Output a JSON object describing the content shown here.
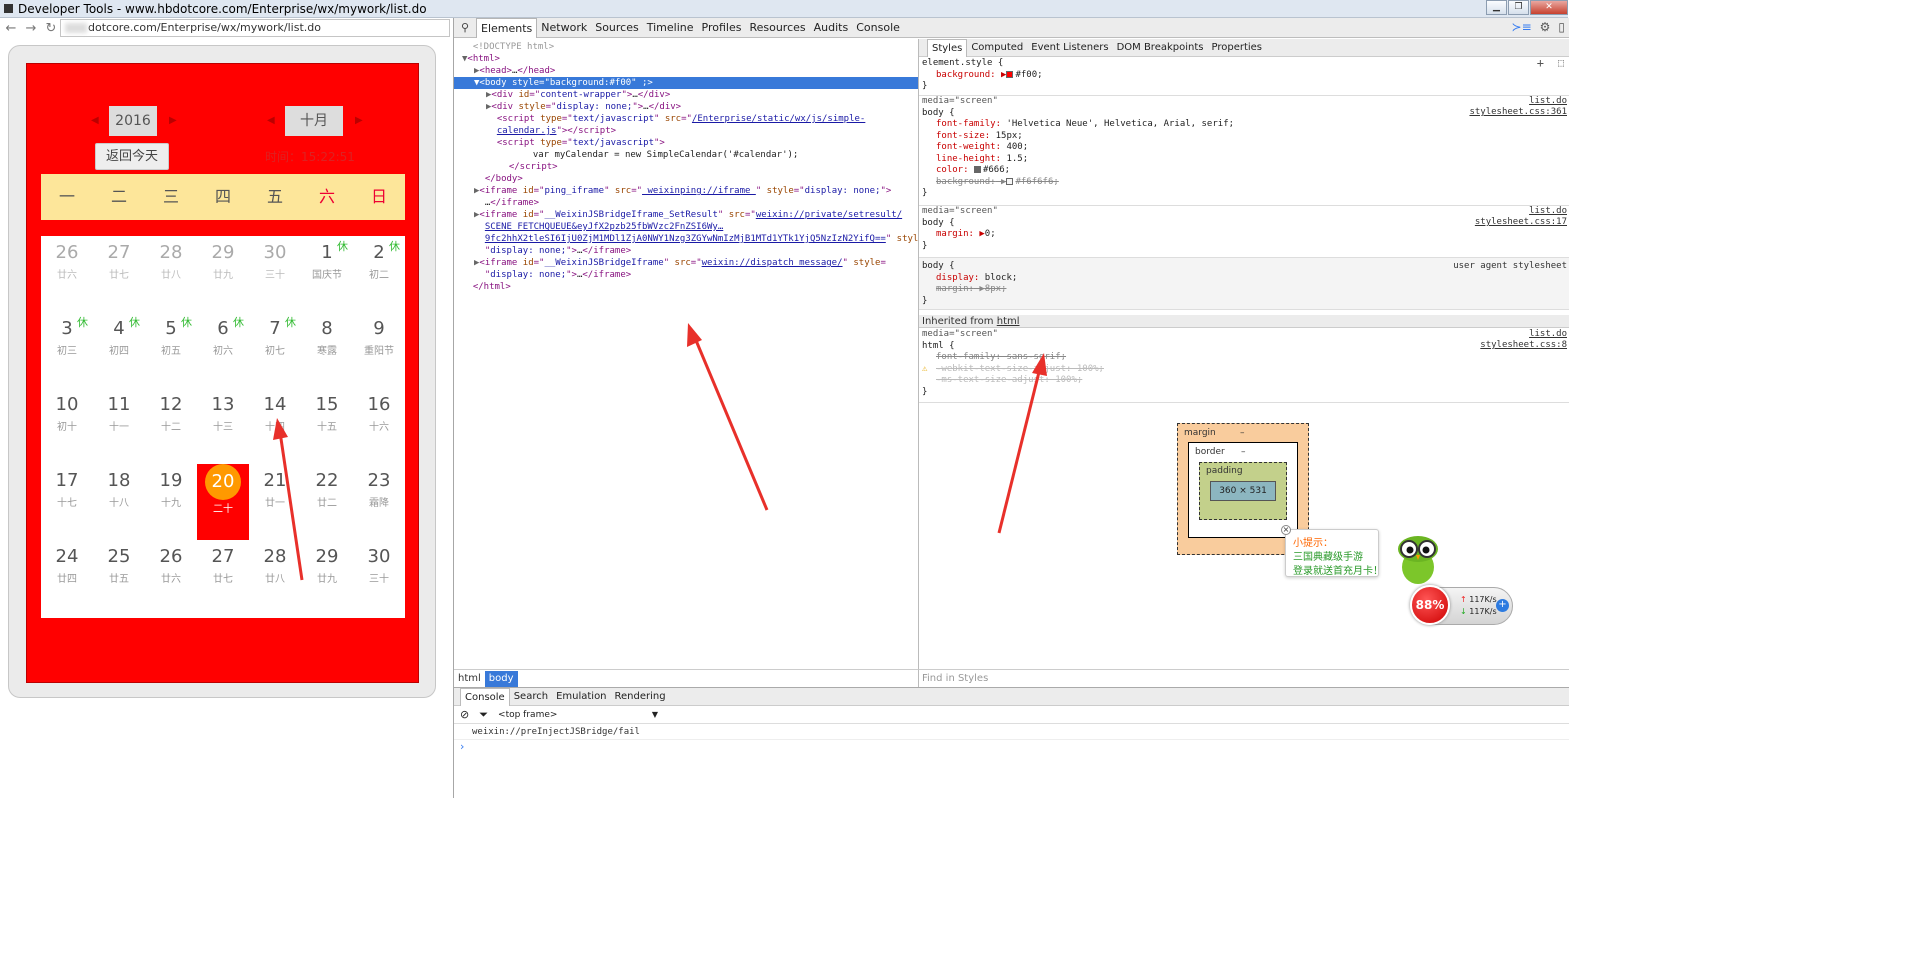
{
  "window": {
    "title": "Developer Tools - www.hbdotcore.com/Enterprise/wx/mywork/list.do"
  },
  "address": {
    "url": "dotcore.com/Enterprise/wx/mywork/list.do"
  },
  "calendar": {
    "year": "2016",
    "month": "十月",
    "today_button": "返回今天",
    "time_text": "时间：15:22:51",
    "weekdays": [
      "一",
      "二",
      "三",
      "四",
      "五",
      "六",
      "日"
    ],
    "days": [
      {
        "n": "26",
        "l": "廿六",
        "dim": true
      },
      {
        "n": "27",
        "l": "廿七",
        "dim": true
      },
      {
        "n": "28",
        "l": "廿八",
        "dim": true
      },
      {
        "n": "29",
        "l": "廿九",
        "dim": true
      },
      {
        "n": "30",
        "l": "三十",
        "dim": true
      },
      {
        "n": "1",
        "l": "国庆节",
        "rest": "休"
      },
      {
        "n": "2",
        "l": "初二",
        "rest": "休"
      },
      {
        "n": "3",
        "l": "初三",
        "rest": "休"
      },
      {
        "n": "4",
        "l": "初四",
        "rest": "休"
      },
      {
        "n": "5",
        "l": "初五",
        "rest": "休"
      },
      {
        "n": "6",
        "l": "初六",
        "rest": "休"
      },
      {
        "n": "7",
        "l": "初七",
        "rest": "休"
      },
      {
        "n": "8",
        "l": "寒露"
      },
      {
        "n": "9",
        "l": "重阳节"
      },
      {
        "n": "10",
        "l": "初十"
      },
      {
        "n": "11",
        "l": "十一"
      },
      {
        "n": "12",
        "l": "十二"
      },
      {
        "n": "13",
        "l": "十三"
      },
      {
        "n": "14",
        "l": "十四"
      },
      {
        "n": "15",
        "l": "十五"
      },
      {
        "n": "16",
        "l": "十六"
      },
      {
        "n": "17",
        "l": "十七"
      },
      {
        "n": "18",
        "l": "十八"
      },
      {
        "n": "19",
        "l": "十九"
      },
      {
        "n": "20",
        "l": "二十",
        "today": true
      },
      {
        "n": "21",
        "l": "廿一"
      },
      {
        "n": "22",
        "l": "廿二"
      },
      {
        "n": "23",
        "l": "霜降"
      },
      {
        "n": "24",
        "l": "廿四"
      },
      {
        "n": "25",
        "l": "廿五"
      },
      {
        "n": "26",
        "l": "廿六"
      },
      {
        "n": "27",
        "l": "廿七"
      },
      {
        "n": "28",
        "l": "廿八"
      },
      {
        "n": "29",
        "l": "廿九"
      },
      {
        "n": "30",
        "l": "三十"
      }
    ]
  },
  "devtools": {
    "tabs": [
      "Elements",
      "Network",
      "Sources",
      "Timeline",
      "Profiles",
      "Resources",
      "Audits",
      "Console"
    ],
    "dom": [
      {
        "ind": 0,
        "html": "<span class='c'>&lt;!DOCTYPE html&gt;</span>"
      },
      {
        "ind": 0,
        "tri": "▼",
        "html": "&lt;html&gt;"
      },
      {
        "ind": 1,
        "tri": "▶",
        "html": "&lt;head&gt;<span class='tx'>…</span>&lt;/head&gt;"
      },
      {
        "ind": 1,
        "tri": "▼",
        "sel": true,
        "html": "&lt;body <span class='an'>style</span>=\"<span class='av'>background:#f00</span>\" ;&gt;"
      },
      {
        "ind": 2,
        "tri": "▶",
        "html": "&lt;div <span class='an'>id</span>=\"<span class='av'>content-wrapper</span>\"&gt;<span class='tx'>…</span>&lt;/div&gt;"
      },
      {
        "ind": 2,
        "tri": "▶",
        "html": "&lt;div <span class='an'>style</span>=\"<span class='av'>display: none;</span>\"&gt;<span class='tx'>…</span>&lt;/div&gt;"
      },
      {
        "ind": 2,
        "html": "&lt;script <span class='an'>type</span>=\"<span class='av'>text/javascript</span>\" <span class='an'>src</span>=\"<span class='lnk'>/Enterprise/static/wx/js/simple-</span>"
      },
      {
        "ind": 2,
        "html": "<span class='lnk'>calendar.js</span>\"&gt;&lt;/script&gt;"
      },
      {
        "ind": 2,
        "html": "&lt;script <span class='an'>type</span>=\"<span class='av'>text/javascript</span>\"&gt;"
      },
      {
        "ind": 5,
        "html": "<span class='tx'>var myCalendar = new SimpleCalendar('#calendar');</span>"
      },
      {
        "ind": 3,
        "html": "&lt;/script&gt;"
      },
      {
        "ind": 1,
        "html": "&lt;/body&gt;"
      },
      {
        "ind": 1,
        "tri": "▶",
        "html": "&lt;iframe <span class='an'>id</span>=\"<span class='av'>ping_iframe</span>\" <span class='an'>src</span>=\"<span class='lnk'> weixinping://iframe </span>\" <span class='an'>style</span>=\"<span class='av'>display: none;</span>\"&gt;"
      },
      {
        "ind": 1,
        "html": "<span class='tx'>…</span>&lt;/iframe&gt;"
      },
      {
        "ind": 1,
        "tri": "▶",
        "html": "&lt;iframe <span class='an'>id</span>=\"<span class='av'>__WeixinJSBridgeIframe_SetResult</span>\" <span class='an'>src</span>=\"<span class='lnk'>weixin://private/setresult/</span>"
      },
      {
        "ind": 1,
        "html": "<span class='lnk'>SCENE_FETCHQUEUE&amp;eyJfX2pzb25fbWVzc2FnZSI6Wy…</span>"
      },
      {
        "ind": 1,
        "html": "<span class='lnk'>9fc2hhX2tleSI6IjU0ZjM1MDl1ZjA0NWY1Nzg3ZGYwNmIzMjB1MTd1YTk1YjQ5NzIzN2YifQ==</span>\" <span class='an'>style</span>="
      },
      {
        "ind": 1,
        "html": "\"<span class='av'>display: none;</span>\"&gt;<span class='tx'>…</span>&lt;/iframe&gt;"
      },
      {
        "ind": 1,
        "tri": "▶",
        "html": "&lt;iframe <span class='an'>id</span>=\"<span class='av'>__WeixinJSBridgeIframe</span>\" <span class='an'>src</span>=\"<span class='lnk'>weixin://dispatch_message/</span>\" <span class='an'>style</span>="
      },
      {
        "ind": 1,
        "html": "\"<span class='av'>display: none;</span>\"&gt;<span class='tx'>…</span>&lt;/iframe&gt;"
      },
      {
        "ind": 0,
        "html": "&lt;/html&gt;"
      }
    ],
    "style_tabs": [
      "Styles",
      "Computed",
      "Event Listeners",
      "DOM Breakpoints",
      "Properties"
    ],
    "element_style": {
      "selector": "element.style {",
      "prop": "background:",
      "value": "#f00;",
      "swatch": "#ff0000"
    },
    "rule1": {
      "media": "media=\"screen\"",
      "src1": "list.do",
      "src2": "stylesheet.css:361",
      "selector": "body {",
      "props": [
        [
          "font-family:",
          "'Helvetica Neue', Helvetica, Arial, serif;"
        ],
        [
          "font-size:",
          "15px;"
        ],
        [
          "font-weight:",
          "400;"
        ],
        [
          "line-height:",
          "1.5;"
        ],
        [
          "color:",
          "#666;"
        ]
      ],
      "strike_prop": "background:",
      "strike_val": "#f6f6f6;"
    },
    "rule2": {
      "media": "media=\"screen\"",
      "src1": "list.do",
      "src2": "stylesheet.css:17",
      "selector": "body {",
      "prop": "margin:",
      "value": "0;"
    },
    "rule3": {
      "selector": "body {",
      "ua": "user agent stylesheet",
      "prop": "display:",
      "value": "block;",
      "strike_prop": "margin:",
      "strike_val": "8px;"
    },
    "inherited": "Inherited from",
    "inherited_tag": "html",
    "rule4": {
      "media": "media=\"screen\"",
      "src1": "list.do",
      "src2": "stylesheet.css:8",
      "selector": "html {",
      "p1": "font-family: sans-serif;",
      "p2": "-webkit-text-size-adjust: 100%;",
      "p3": "-ms-text-size-adjust: 100%;"
    },
    "boxmodel": {
      "margin": "margin",
      "border": "border",
      "padding": "padding",
      "content": "360 × 531",
      "dash": "–"
    },
    "find_styles": "Find in Styles",
    "crumbs": [
      "html",
      "body"
    ],
    "drawer_tabs": [
      "Console",
      "Search",
      "Emulation",
      "Rendering"
    ],
    "frame": "<top frame>",
    "console_msg": "weixin://preInjectJSBridge/fail",
    "prompt": "›"
  },
  "overlay": {
    "tip_title": "小提示：",
    "tip_line1": "三国典藏级手游",
    "tip_line2": "登录就送首充月卡！",
    "percent": "88%",
    "up_speed": "117K/s",
    "down_speed": "117K/s"
  }
}
